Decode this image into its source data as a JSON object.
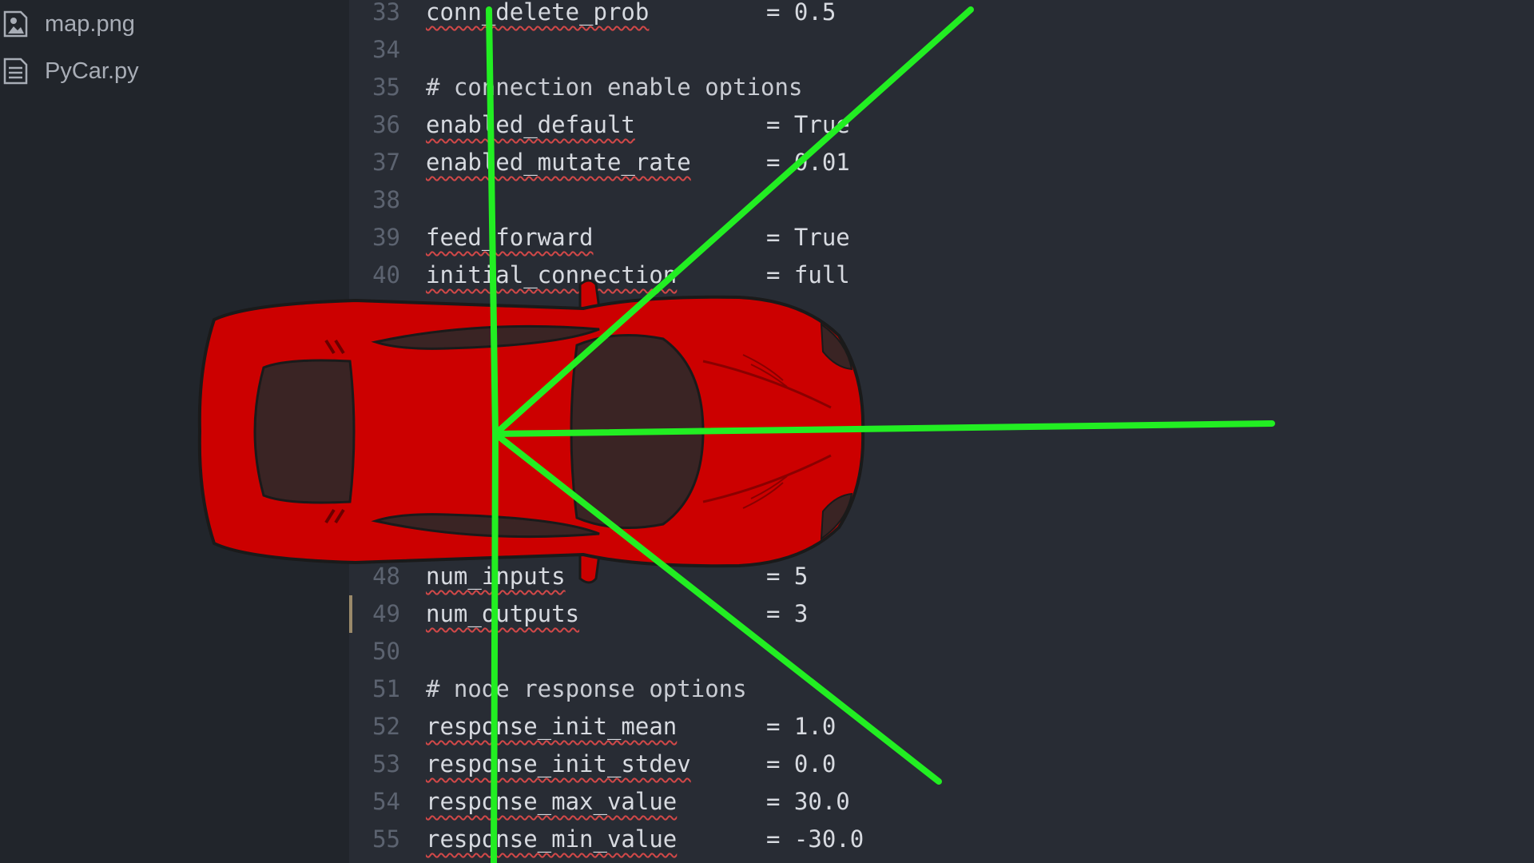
{
  "sidebar": {
    "files": [
      {
        "name": "map.png",
        "icon": "image-file-icon"
      },
      {
        "name": "PyCar.py",
        "icon": "text-file-icon"
      }
    ]
  },
  "editor": {
    "lines": [
      {
        "num": "33",
        "key": "conn_delete_prob",
        "value": "= 0.5"
      },
      {
        "num": "34",
        "key": "",
        "value": ""
      },
      {
        "num": "35",
        "comment": "# connection enable options"
      },
      {
        "num": "36",
        "key": "enabled_default",
        "value": "= True"
      },
      {
        "num": "37",
        "key": "enabled_mutate_rate",
        "value": "= 0.01"
      },
      {
        "num": "38",
        "key": "",
        "value": ""
      },
      {
        "num": "39",
        "key": "feed_forward",
        "value": "= True"
      },
      {
        "num": "40",
        "key": "initial_connection",
        "value": "= full"
      },
      {
        "num": "48",
        "key": "num_inputs",
        "value": "= 5"
      },
      {
        "num": "49",
        "key": "num_outputs",
        "value": "= 3"
      },
      {
        "num": "50",
        "key": "",
        "value": ""
      },
      {
        "num": "51",
        "comment": "# node response options"
      },
      {
        "num": "52",
        "key": "response_init_mean",
        "value": "= 1.0"
      },
      {
        "num": "53",
        "key": "response_init_stdev",
        "value": "= 0.0"
      },
      {
        "num": "54",
        "key": "response_max_value",
        "value": "= 30.0"
      },
      {
        "num": "55",
        "key": "response_min_value",
        "value": "= -30.0"
      }
    ]
  },
  "overlay": {
    "car_color": "#cc0000",
    "sensor_color": "#22ee22",
    "sensor_rays": 5
  }
}
